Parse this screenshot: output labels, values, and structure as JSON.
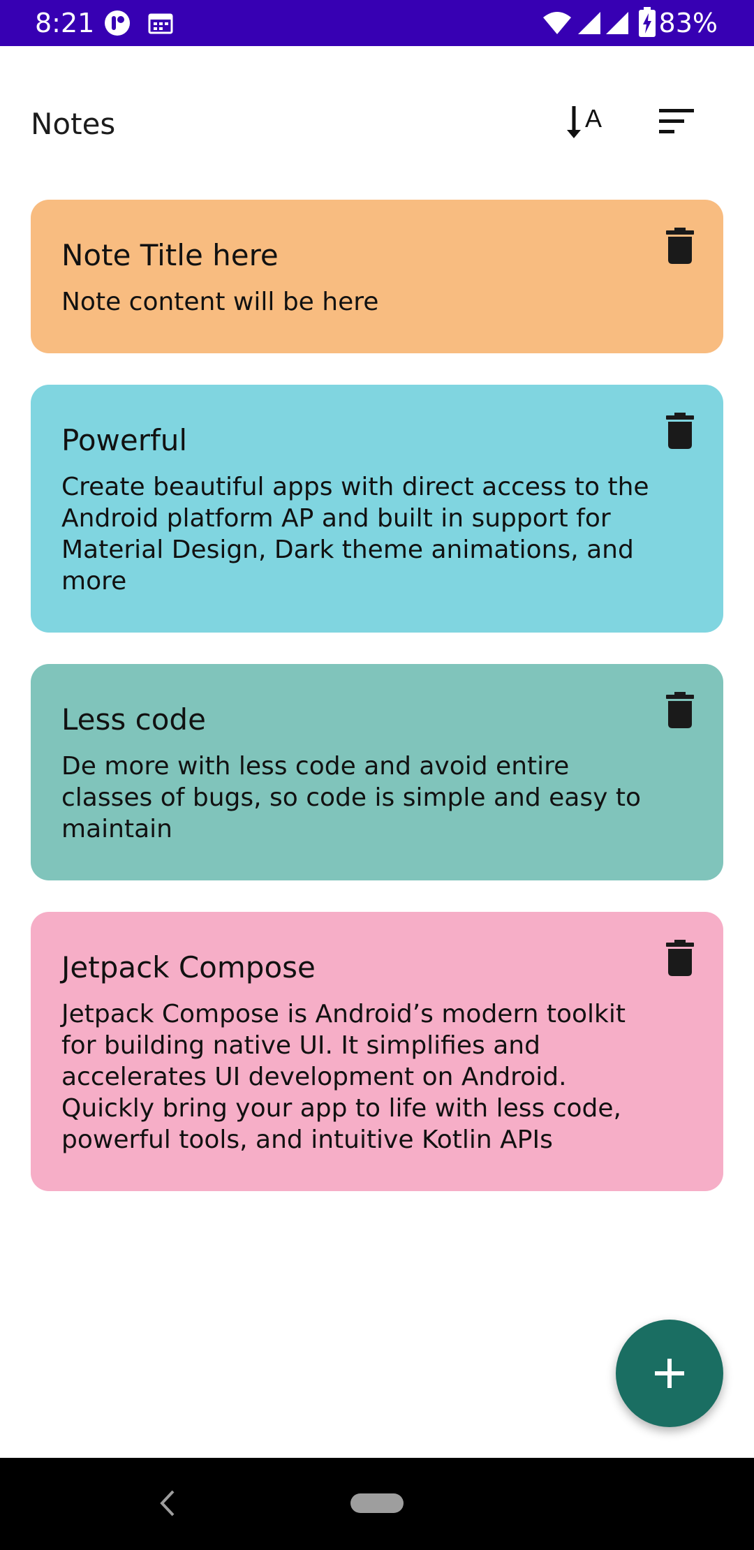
{
  "status_bar": {
    "time": "8:21",
    "battery": "83%",
    "background": "#3700b3",
    "icons": [
      "app-notification-icon",
      "calendar-icon",
      "wifi-icon",
      "signal-icon",
      "signal-icon",
      "battery-charging-icon"
    ]
  },
  "top_bar": {
    "title": "Notes",
    "actions": [
      {
        "name": "sort-alphabetical-icon"
      },
      {
        "name": "filter-sort-icon"
      }
    ]
  },
  "notes": [
    {
      "title": "Note Title here",
      "content": "Note content will be here",
      "color": "#f8bc80"
    },
    {
      "title": "Powerful",
      "content": "Create beautiful apps with direct access to the Android platform AP and built in support for Material Design, Dark theme animations, and more",
      "color": "#80d5e0"
    },
    {
      "title": "Less code",
      "content": "De more with less code and avoid entire classes of bugs, so code is simple and easy to maintain",
      "color": "#80c4bb"
    },
    {
      "title": "Jetpack Compose",
      "content": "Jetpack Compose is Android’s modern toolkit for building native UI. It simplifies and accelerates UI development on Android. Quickly bring your app to life with less code, powerful tools, and intuitive Kotlin APIs",
      "color": "#f6aec7"
    }
  ],
  "fab": {
    "icon": "plus-icon",
    "color": "#1a6e62"
  },
  "nav_bar": {
    "back": "back-icon",
    "home": "home-pill"
  }
}
